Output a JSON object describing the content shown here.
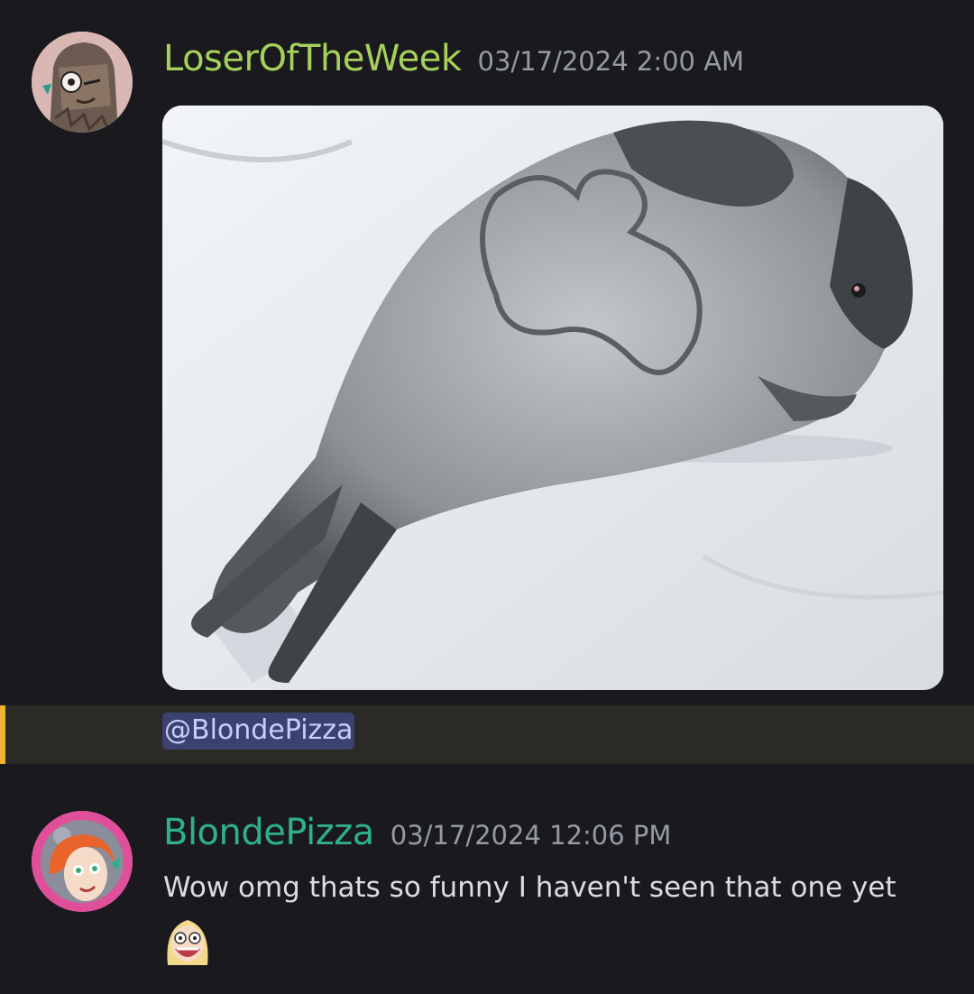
{
  "messages": [
    {
      "username": "LoserOfTheWeek",
      "timestamp": "03/17/2024 2:00 AM",
      "avatar_icon": "hooded-character-avatar",
      "attachment_icon": "seal-on-snow-photo",
      "mention": "@BlondePizza",
      "colors": {
        "username": "#a6d15a",
        "mention_bar": "#f0b232"
      }
    },
    {
      "username": "BlondePizza",
      "timestamp": "03/17/2024 12:06 PM",
      "avatar_icon": "red-haired-character-avatar",
      "content": "Wow omg thats so funny I haven't seen that one yet",
      "emoji_icon": "blonde-girl-laughing-emoji",
      "colors": {
        "username": "#2fb08a"
      }
    }
  ]
}
